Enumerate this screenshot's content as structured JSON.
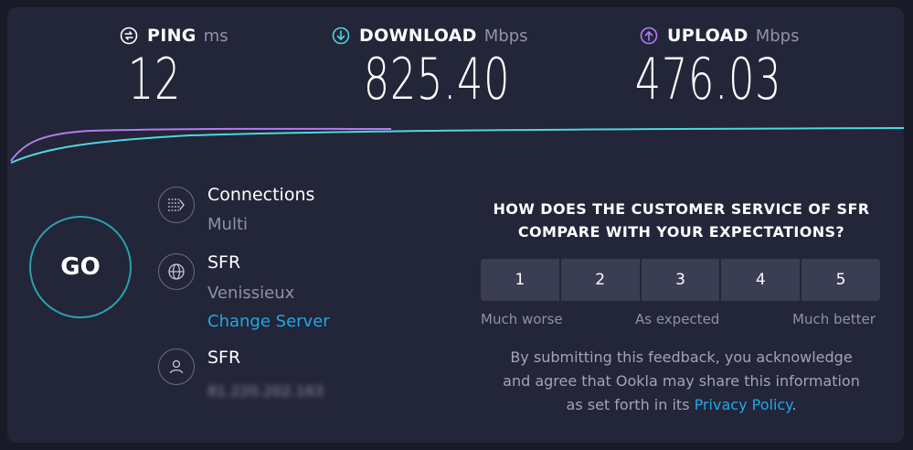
{
  "metrics": {
    "ping": {
      "label": "PING",
      "unit": "ms",
      "value": "12",
      "icon": "ping-icon"
    },
    "download": {
      "label": "DOWNLOAD",
      "unit": "Mbps",
      "value": "825.40",
      "icon": "download-arrow-icon"
    },
    "upload": {
      "label": "UPLOAD",
      "unit": "Mbps",
      "value": "476.03",
      "icon": "upload-arrow-icon"
    }
  },
  "colors": {
    "download": "#4fd6e0",
    "upload": "#b27cf2",
    "go_ring": "#2aa0ae",
    "link": "#1fa8e8"
  },
  "go_label": "GO",
  "connections": {
    "title": "Connections",
    "value": "Multi",
    "icon": "connections-icon"
  },
  "server": {
    "name": "SFR",
    "location": "Venissieux",
    "change_label": "Change Server",
    "icon": "globe-icon"
  },
  "isp": {
    "name": "SFR",
    "ip": "81.220.202.163",
    "icon": "user-icon"
  },
  "survey": {
    "question_line1": "HOW DOES THE CUSTOMER SERVICE OF SFR",
    "question_line2": "COMPARE WITH YOUR EXPECTATIONS?",
    "options": [
      "1",
      "2",
      "3",
      "4",
      "5"
    ],
    "low_label": "Much worse",
    "mid_label": "As expected",
    "high_label": "Much better",
    "disclaimer_line1": "By submitting this feedback, you acknowledge",
    "disclaimer_line2": "and agree that Ookla may share this information",
    "disclaimer_line3_prefix": "as set forth in its ",
    "privacy_link": "Privacy Policy",
    "disclaimer_line3_suffix": "."
  }
}
